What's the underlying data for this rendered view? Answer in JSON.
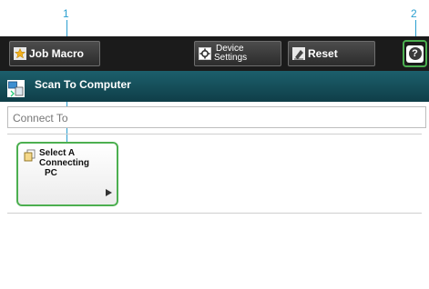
{
  "callouts": [
    "1",
    "2"
  ],
  "toolbar": {
    "job_macro_label": "Job Macro",
    "device_settings_line1": "Device",
    "device_settings_line2": "Settings",
    "reset_label": "Reset",
    "help_label": "?"
  },
  "title": "Scan To Computer",
  "connect_to": {
    "placeholder": "Connect To"
  },
  "tile": {
    "line1": "Select A",
    "line2": "Connecting",
    "line3": "PC"
  },
  "colors": {
    "accent": "#4caf50",
    "callout": "#2a9fd0",
    "titlebar": "#164e5a",
    "toolbar": "#1b1b1b"
  }
}
